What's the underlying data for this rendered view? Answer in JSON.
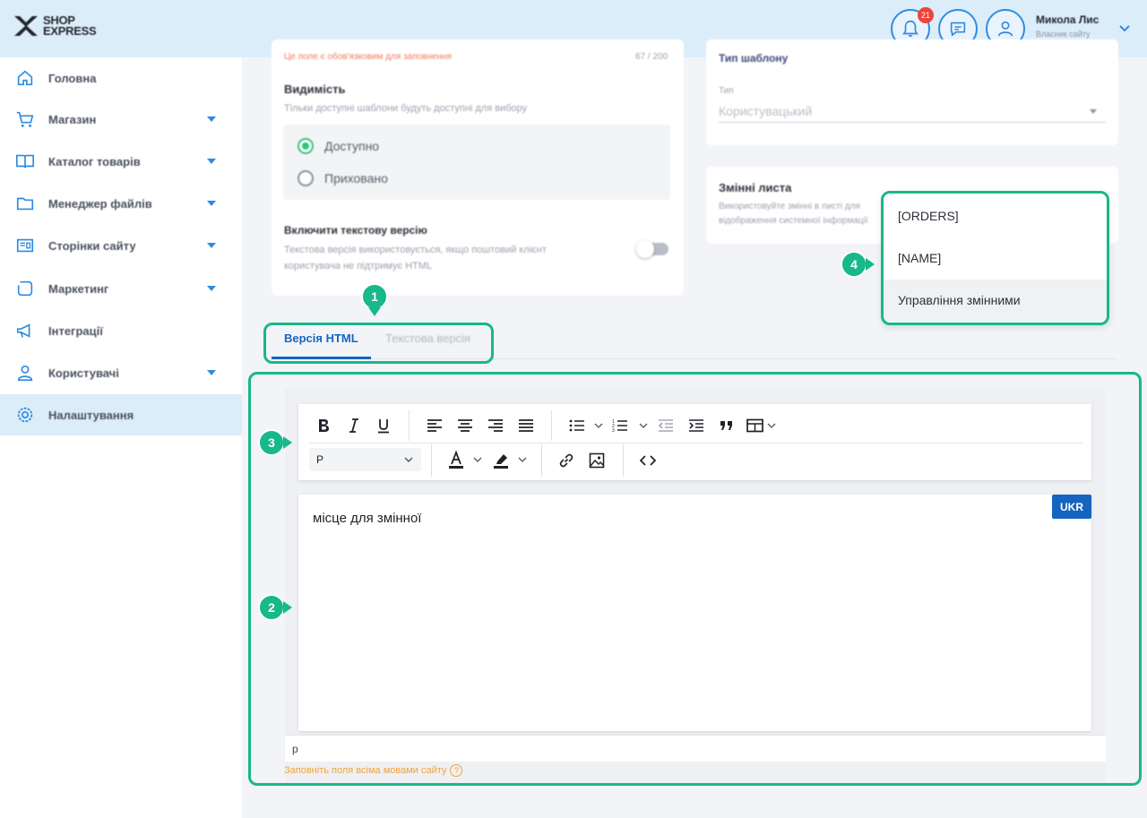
{
  "brand": {
    "line1": "SHOP",
    "line2": "EXPRESS"
  },
  "header": {
    "notifications_count": "21",
    "user_name": "Микола Лис",
    "user_role": "Власник сайту"
  },
  "sidebar": {
    "items": [
      {
        "label": "Головна",
        "icon": "home-icon",
        "has_submenu": false
      },
      {
        "label": "Магазин",
        "icon": "cart-icon",
        "has_submenu": true
      },
      {
        "label": "Каталог товарів",
        "icon": "book-icon",
        "has_submenu": true
      },
      {
        "label": "Менеджер файлів",
        "icon": "folder-icon",
        "has_submenu": true
      },
      {
        "label": "Сторінки сайту",
        "icon": "pages-icon",
        "has_submenu": true
      },
      {
        "label": "Маркетинг",
        "icon": "marketing-icon",
        "has_submenu": true
      },
      {
        "label": "Інтеграції",
        "icon": "megaphone-icon",
        "has_submenu": false
      },
      {
        "label": "Користувачі",
        "icon": "users-icon",
        "has_submenu": true
      },
      {
        "label": "Налаштування",
        "icon": "settings-icon",
        "has_submenu": false,
        "active": true
      }
    ]
  },
  "settings_card": {
    "field_hint": "Це поле є обов'язковим для заповнення",
    "char_counter": "67 / 200",
    "visibility_title": "Видимість",
    "visibility_desc": "Тільки доступні шаблони будуть доступні для вибору",
    "option_available": "Доступно",
    "option_hidden": "Приховано",
    "text_version_title": "Включити текстову версію",
    "text_version_desc_1": "Текстова версія використовується, якщо поштовий клієнт",
    "text_version_desc_2": "користувача не підтримує HTML"
  },
  "template_type_card": {
    "title": "Тип шаблону",
    "field_label": "Тип",
    "field_value": "Користувацький"
  },
  "variables_card": {
    "title": "Змінні листа",
    "desc_1": "Використовуйте змінні в листі для",
    "desc_2": "відображення системної інформації"
  },
  "tabs": {
    "html": "Версія HTML",
    "text": "Текстова версія"
  },
  "editor": {
    "format_value": "P",
    "content": "місце для змінної",
    "language_badge": "UKR",
    "status_path": "p",
    "hint": "Заповніть поля всіма мовами сайту",
    "hint_icon": "?"
  },
  "variables_dropdown": {
    "items": [
      "[ORDERS]",
      "[NAME]",
      "Управління змінними"
    ]
  },
  "callouts": {
    "n1": "1",
    "n2": "2",
    "n3": "3",
    "n4": "4"
  },
  "colors": {
    "accent": "#17b889",
    "primary": "#1565c0",
    "topbar": "#dcedfa"
  }
}
